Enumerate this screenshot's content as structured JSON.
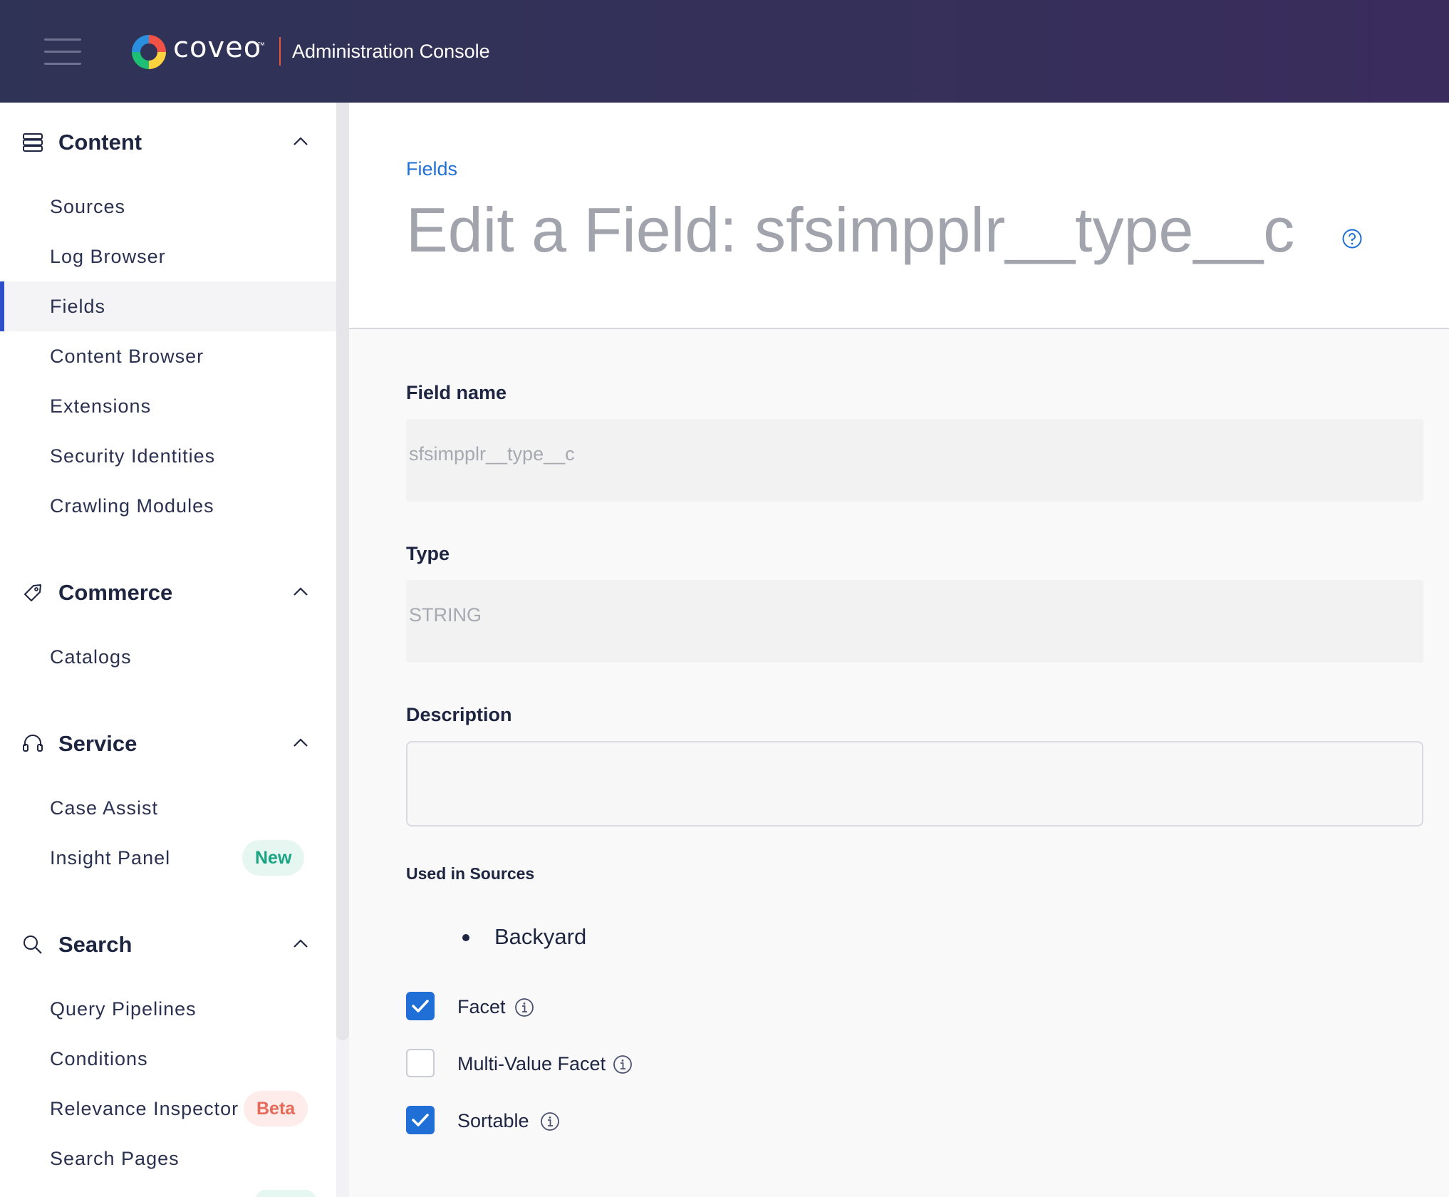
{
  "header": {
    "brand": "coveo",
    "brand_tm": "™",
    "app_title": "Administration Console"
  },
  "sidebar": {
    "sections": [
      {
        "label": "Content",
        "icon": "server-icon",
        "items": [
          {
            "label": "Sources"
          },
          {
            "label": "Log Browser"
          },
          {
            "label": "Fields",
            "active": true
          },
          {
            "label": "Content Browser"
          },
          {
            "label": "Extensions"
          },
          {
            "label": "Security Identities"
          },
          {
            "label": "Crawling Modules"
          }
        ]
      },
      {
        "label": "Commerce",
        "icon": "tag-icon",
        "items": [
          {
            "label": "Catalogs"
          }
        ]
      },
      {
        "label": "Service",
        "icon": "headset-icon",
        "items": [
          {
            "label": "Case Assist"
          },
          {
            "label": "Insight Panel",
            "badge": "New"
          }
        ]
      },
      {
        "label": "Search",
        "icon": "search-icon",
        "items": [
          {
            "label": "Query Pipelines"
          },
          {
            "label": "Conditions"
          },
          {
            "label": "Relevance Inspector",
            "badge": "Beta"
          },
          {
            "label": "Search Pages"
          }
        ]
      }
    ]
  },
  "main": {
    "breadcrumb": "Fields",
    "title": "Edit a Field: sfsimpplr__type__c",
    "field_name_label": "Field name",
    "field_name_value": "sfsimpplr__type__c",
    "type_label": "Type",
    "type_value": "STRING",
    "description_label": "Description",
    "description_value": "",
    "used_in_sources_label": "Used in Sources",
    "sources": [
      "Backyard"
    ],
    "options": [
      {
        "label": "Facet",
        "checked": true
      },
      {
        "label": "Multi-Value Facet",
        "checked": false
      },
      {
        "label": "Sortable",
        "checked": true
      }
    ]
  },
  "colors": {
    "header_bg": "#2f3356",
    "accent_blue": "#1f6fd6",
    "active_indicator": "#2e4fc7",
    "badge_new": "#1aa383",
    "badge_beta": "#e66a5a"
  }
}
